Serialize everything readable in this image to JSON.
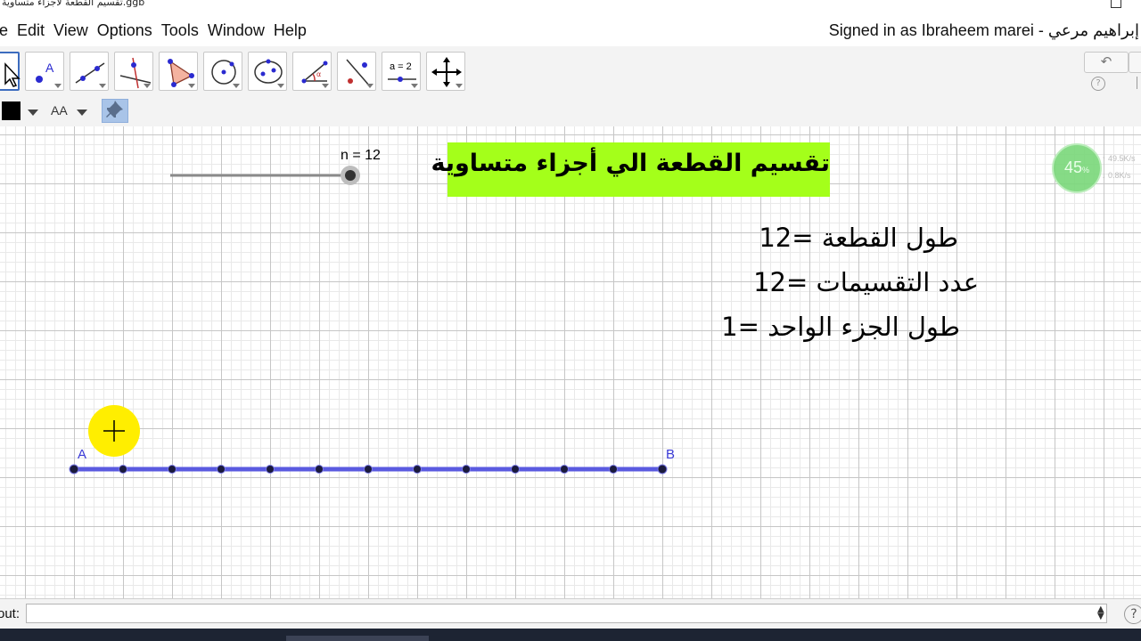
{
  "window": {
    "title": "تقسيم القطعة لاجزاء متساوية.ggb"
  },
  "menu": {
    "items": [
      "e",
      "Edit",
      "View",
      "Options",
      "Tools",
      "Window",
      "Help"
    ],
    "signed_in": "Signed in as Ibraheem marei - إبراهيم مرعي"
  },
  "toolbar": {
    "tools": [
      {
        "name": "move-tool",
        "icon": "cursor-arrow-icon",
        "active": true
      },
      {
        "name": "point-tool",
        "icon": "point-icon",
        "label": "A"
      },
      {
        "name": "line-tool",
        "icon": "line-icon"
      },
      {
        "name": "perpendicular-tool",
        "icon": "perpendicular-icon"
      },
      {
        "name": "polygon-tool",
        "icon": "polygon-icon"
      },
      {
        "name": "circle-tool",
        "icon": "circle-icon"
      },
      {
        "name": "conic-tool",
        "icon": "ellipse-icon"
      },
      {
        "name": "angle-tool",
        "icon": "angle-icon"
      },
      {
        "name": "reflect-tool",
        "icon": "reflect-icon"
      },
      {
        "name": "slider-tool",
        "icon": "slider-icon",
        "label": "a = 2"
      },
      {
        "name": "move-graphics-tool",
        "icon": "move-arrows-icon"
      }
    ],
    "undo_icon": "undo-icon",
    "help_label": "?"
  },
  "stylebar": {
    "color": "#000000",
    "text_size_label": "AA"
  },
  "graphics": {
    "title": "تقسيم القطعة الي أجزاء متساوية",
    "title_bg": "#a4ff1a",
    "slider": {
      "label": "n = 12",
      "value": 12
    },
    "lines": [
      "طول القطعة =12",
      "عدد التقسيمات =12",
      "طول الجزء الواحد =1"
    ],
    "segment": {
      "start_label": "A",
      "end_label": "B",
      "divisions": 12,
      "color": "#5a5ae0",
      "point_color": "#1a1a3c"
    },
    "cursor": {
      "icon": "crosshair-cursor-icon",
      "highlight": "#ffee00"
    }
  },
  "overlay": {
    "gauge_percent": "45",
    "gauge_unit": "%",
    "upload": "49.5K/s",
    "download": "0.8K/s"
  },
  "input_bar": {
    "label": "out:",
    "placeholder": "",
    "help": "?"
  }
}
